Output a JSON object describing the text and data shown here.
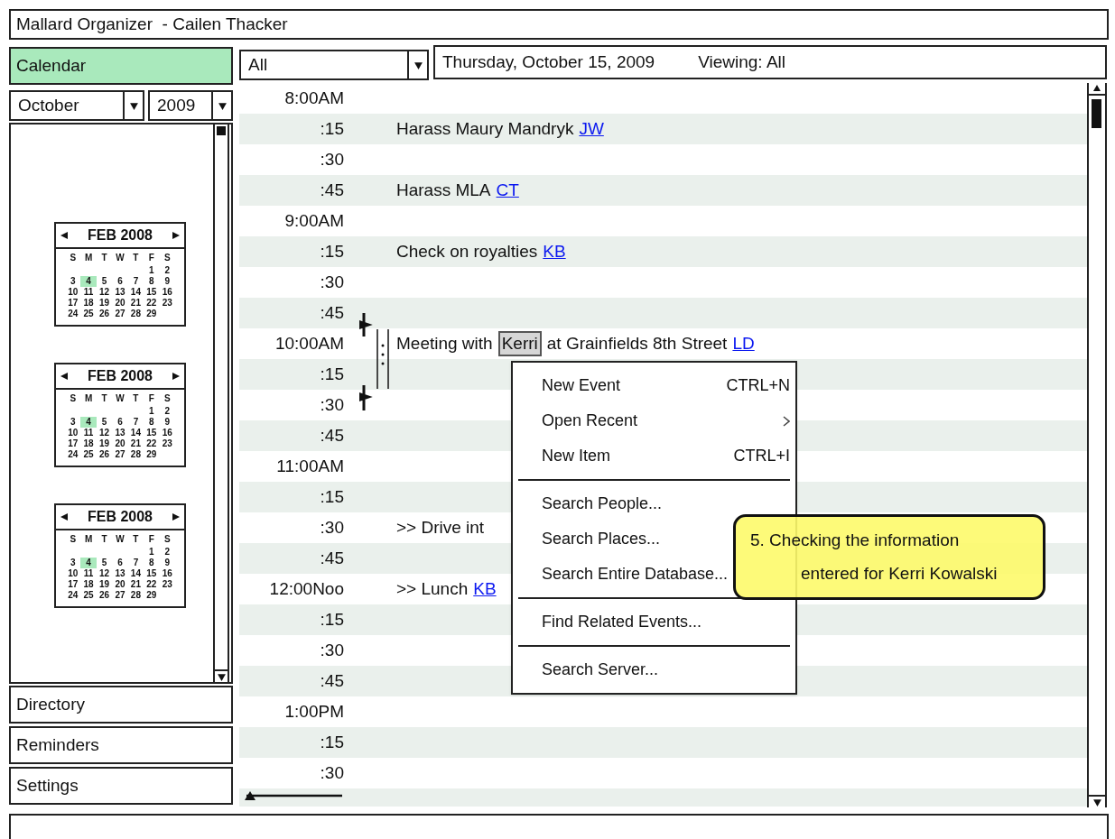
{
  "window": {
    "title": "Mallard Organizer  - Cailen Thacker"
  },
  "sidebar": {
    "top_items": [
      {
        "label": "Calendar",
        "selected": true
      }
    ],
    "month_dropdown": {
      "value": "October"
    },
    "year_dropdown": {
      "value": "2009"
    },
    "mini_calendars": [
      {
        "month": "FEB 2008",
        "weekdays": [
          "S",
          "M",
          "T",
          "W",
          "T",
          "F",
          "S"
        ],
        "weeks": [
          [
            {
              "d": "1",
              "selected": false
            },
            {
              "d": "2",
              "selected": false
            }
          ],
          [
            {
              "d": "3",
              "selected": false
            },
            {
              "d": "4",
              "selected": true
            },
            {
              "d": "5",
              "selected": false
            },
            {
              "d": "6",
              "selected": false
            },
            {
              "d": "7",
              "selected": false
            },
            {
              "d": "8",
              "selected": false
            },
            {
              "d": "9",
              "selected": false
            }
          ],
          [
            {
              "d": "10",
              "selected": false
            },
            {
              "d": "11",
              "selected": false
            },
            {
              "d": "12",
              "selected": false
            },
            {
              "d": "13",
              "selected": false
            },
            {
              "d": "14",
              "selected": false
            },
            {
              "d": "15",
              "selected": false
            },
            {
              "d": "16",
              "selected": false
            }
          ],
          [
            {
              "d": "17",
              "selected": false
            },
            {
              "d": "18",
              "selected": false
            },
            {
              "d": "19",
              "selected": false
            },
            {
              "d": "20",
              "selected": false
            },
            {
              "d": "21",
              "selected": false
            },
            {
              "d": "22",
              "selected": false
            },
            {
              "d": "23",
              "selected": false
            }
          ],
          [
            {
              "d": "24",
              "selected": false
            },
            {
              "d": "25",
              "selected": false
            },
            {
              "d": "26",
              "selected": false
            },
            {
              "d": "27",
              "selected": false
            },
            {
              "d": "28",
              "selected": false
            },
            {
              "d": "29",
              "selected": false
            }
          ]
        ]
      },
      {
        "month": "FEB 2008",
        "weekdays": [
          "S",
          "M",
          "T",
          "W",
          "T",
          "F",
          "S"
        ],
        "weeks": [
          [
            {
              "d": "1",
              "selected": false
            },
            {
              "d": "2",
              "selected": false
            }
          ],
          [
            {
              "d": "3",
              "selected": false
            },
            {
              "d": "4",
              "selected": true
            },
            {
              "d": "5",
              "selected": false
            },
            {
              "d": "6",
              "selected": false
            },
            {
              "d": "7",
              "selected": false
            },
            {
              "d": "8",
              "selected": false
            },
            {
              "d": "9",
              "selected": false
            }
          ],
          [
            {
              "d": "10",
              "selected": false
            },
            {
              "d": "11",
              "selected": false
            },
            {
              "d": "12",
              "selected": false
            },
            {
              "d": "13",
              "selected": false
            },
            {
              "d": "14",
              "selected": false
            },
            {
              "d": "15",
              "selected": false
            },
            {
              "d": "16",
              "selected": false
            }
          ],
          [
            {
              "d": "17",
              "selected": false
            },
            {
              "d": "18",
              "selected": false
            },
            {
              "d": "19",
              "selected": false
            },
            {
              "d": "20",
              "selected": false
            },
            {
              "d": "21",
              "selected": false
            },
            {
              "d": "22",
              "selected": false
            },
            {
              "d": "23",
              "selected": false
            }
          ],
          [
            {
              "d": "24",
              "selected": false
            },
            {
              "d": "25",
              "selected": false
            },
            {
              "d": "26",
              "selected": false
            },
            {
              "d": "27",
              "selected": false
            },
            {
              "d": "28",
              "selected": false
            },
            {
              "d": "29",
              "selected": false
            }
          ]
        ]
      },
      {
        "month": "FEB 2008",
        "weekdays": [
          "S",
          "M",
          "T",
          "W",
          "T",
          "F",
          "S"
        ],
        "weeks": [
          [
            {
              "d": "1",
              "selected": false
            },
            {
              "d": "2",
              "selected": false
            }
          ],
          [
            {
              "d": "3",
              "selected": false
            },
            {
              "d": "4",
              "selected": true
            },
            {
              "d": "5",
              "selected": false
            },
            {
              "d": "6",
              "selected": false
            },
            {
              "d": "7",
              "selected": false
            },
            {
              "d": "8",
              "selected": false
            },
            {
              "d": "9",
              "selected": false
            }
          ],
          [
            {
              "d": "10",
              "selected": false
            },
            {
              "d": "11",
              "selected": false
            },
            {
              "d": "12",
              "selected": false
            },
            {
              "d": "13",
              "selected": false
            },
            {
              "d": "14",
              "selected": false
            },
            {
              "d": "15",
              "selected": false
            },
            {
              "d": "16",
              "selected": false
            }
          ],
          [
            {
              "d": "17",
              "selected": false
            },
            {
              "d": "18",
              "selected": false
            },
            {
              "d": "19",
              "selected": false
            },
            {
              "d": "20",
              "selected": false
            },
            {
              "d": "21",
              "selected": false
            },
            {
              "d": "22",
              "selected": false
            },
            {
              "d": "23",
              "selected": false
            }
          ],
          [
            {
              "d": "24",
              "selected": false
            },
            {
              "d": "25",
              "selected": false
            },
            {
              "d": "26",
              "selected": false
            },
            {
              "d": "27",
              "selected": false
            },
            {
              "d": "28",
              "selected": false
            },
            {
              "d": "29",
              "selected": false
            }
          ]
        ]
      }
    ],
    "bottom_items": [
      {
        "label": "Directory",
        "selected": false
      },
      {
        "label": "Reminders",
        "selected": false
      },
      {
        "label": "Settings",
        "selected": false
      }
    ]
  },
  "filter_dropdown": {
    "value": "All"
  },
  "date_header": {
    "date": "Thursday, October 15, 2009",
    "viewing": "Viewing: All"
  },
  "schedule": {
    "rows": [
      {
        "time": "8:00AM"
      },
      {
        "time": ":15",
        "event": {
          "text": "Harass Maury Mandryk",
          "link": "JW"
        }
      },
      {
        "time": ":30"
      },
      {
        "time": ":45",
        "event": {
          "text": "Harass MLA",
          "link": "CT"
        }
      },
      {
        "time": "9:00AM"
      },
      {
        "time": ":15",
        "event": {
          "text": "Check on royalties",
          "link": "KB"
        }
      },
      {
        "time": ":30"
      },
      {
        "time": ":45"
      },
      {
        "time": "10:00AM",
        "event": {
          "text": "Meeting with",
          "highlight": "Kerri",
          "after": "at Grainfields 8th Street",
          "link": "LD"
        }
      },
      {
        "time": ":15"
      },
      {
        "time": ":30"
      },
      {
        "time": ":45"
      },
      {
        "time": "11:00AM"
      },
      {
        "time": ":15"
      },
      {
        "time": ":30",
        "event": {
          "text": ">> Drive int"
        }
      },
      {
        "time": ":45"
      },
      {
        "time": "12:00Noo",
        "event": {
          "text": ">> Lunch",
          "link": "KB"
        }
      },
      {
        "time": ":15"
      },
      {
        "time": ":30"
      },
      {
        "time": ":45"
      },
      {
        "time": "1:00PM"
      },
      {
        "time": ":15"
      },
      {
        "time": ":30"
      }
    ]
  },
  "context_menu": {
    "items": [
      {
        "kind": "item",
        "label": "New Event",
        "shortcut": "CTRL+N"
      },
      {
        "kind": "item",
        "label": "Open Recent",
        "submenu": true
      },
      {
        "kind": "item",
        "label": "New Item",
        "shortcut": "CTRL+I"
      },
      {
        "kind": "separator"
      },
      {
        "kind": "item",
        "label": "Search People..."
      },
      {
        "kind": "item",
        "label": "Search Places..."
      },
      {
        "kind": "item",
        "label": "Search Entire Database..."
      },
      {
        "kind": "separator"
      },
      {
        "kind": "item",
        "label": "Find Related Events..."
      },
      {
        "kind": "separator"
      },
      {
        "kind": "item",
        "label": "Search Server..."
      }
    ]
  },
  "callout": {
    "lines": [
      "5. Checking the information",
      "entered for Kerri Kowalski"
    ]
  }
}
